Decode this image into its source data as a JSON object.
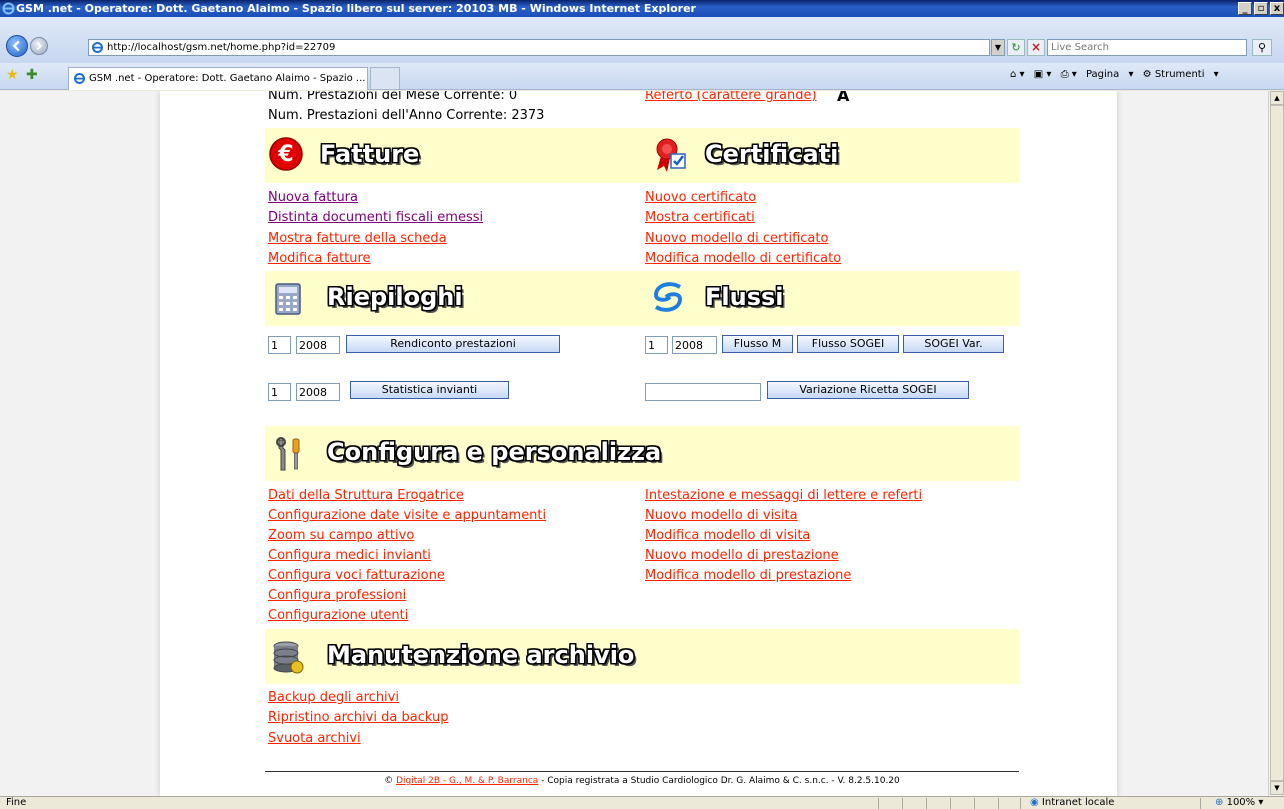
{
  "window": {
    "title": "GSM .net - Operatore: Dott. Gaetano Alaimo - Spazio libero sul server: 20103 MB - Windows Internet Explorer",
    "min_icon": "minimize-icon",
    "max_icon": "maximize-icon",
    "close_icon": "close-icon"
  },
  "address_bar": {
    "url": "http://localhost/gsm.net/home.php?id=22709",
    "search_placeholder": "Live Search"
  },
  "tab": {
    "label": "GSM .net - Operatore: Dott. Gaetano Alaimo - Spazio ..."
  },
  "command_bar": {
    "pagina": "Pagina",
    "strumenti": "Strumenti"
  },
  "top_info": {
    "mese": "Num. Prestazioni del Mese Corrente: 0",
    "anno": "Num. Prestazioni dell'Anno Corrente: 2373",
    "referto_link": "Referto (carattere grande)",
    "referto_suffix": "A"
  },
  "fatture": {
    "title": "Fatture",
    "links": [
      "Nuova fattura",
      "Distinta documenti fiscali emessi",
      "Mostra fatture della scheda",
      "Modifica fatture"
    ]
  },
  "certificati": {
    "title": "Certificati",
    "links": [
      "Nuovo certificato",
      "Mostra certificati",
      "Nuovo modello di certificato",
      "Modifica modello di certificato"
    ]
  },
  "riepiloghi": {
    "title": "Riepiloghi",
    "row1": {
      "month": "1",
      "year": "2008",
      "button": "Rendiconto prestazioni"
    },
    "row2": {
      "month": "1",
      "year": "2008",
      "button": "Statistica invianti"
    }
  },
  "flussi": {
    "title": "Flussi",
    "row1": {
      "month": "1",
      "year": "2008",
      "btn_m": "Flusso M",
      "btn_sogei": "Flusso SOGEI",
      "btn_var": "SOGEI Var."
    },
    "row2": {
      "value": "",
      "button": "Variazione Ricetta SOGEI"
    }
  },
  "configura": {
    "title": "Configura e personalizza",
    "left_links": [
      "Dati della Struttura Erogatrice",
      "Configurazione date visite e appuntamenti",
      "Zoom su campo attivo",
      "Configura medici invianti",
      "Configura voci fatturazione",
      "Configura professioni",
      "Configurazione utenti"
    ],
    "right_links": [
      "Intestazione e messaggi di lettere e referti",
      "Nuovo modello di visita",
      "Modifica modello di visita",
      "Nuovo modello di prestazione",
      "Modifica modello di prestazione"
    ]
  },
  "manutenzione": {
    "title": "Manutenzione archivio",
    "links": [
      "Backup degli archivi",
      "Ripristino archivi da backup",
      "Svuota archivi"
    ]
  },
  "footer": {
    "prefix": "©",
    "link": "Digital 2B - G., M. & P. Barranca",
    "text": "- Copia registrata a Studio Cardiologico Dr. G. Alaimo & C. s.n.c. - V. 8.2.5.10.20"
  },
  "status_bar": {
    "status": "Fine",
    "zone": "Intranet locale",
    "zoom": "100%"
  }
}
